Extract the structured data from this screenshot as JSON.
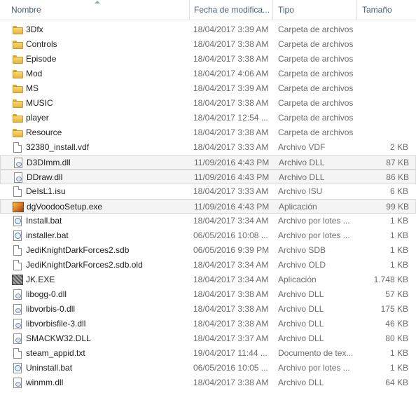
{
  "columns": {
    "name": "Nombre",
    "date": "Fecha de modifica...",
    "type": "Tipo",
    "size": "Tamaño"
  },
  "files": [
    {
      "name": "3Dfx",
      "date": "18/04/2017 3:39 AM",
      "type": "Carpeta de archivos",
      "size": "",
      "icon": "folder-icon"
    },
    {
      "name": "Controls",
      "date": "18/04/2017 3:38 AM",
      "type": "Carpeta de archivos",
      "size": "",
      "icon": "folder-icon"
    },
    {
      "name": "Episode",
      "date": "18/04/2017 3:38 AM",
      "type": "Carpeta de archivos",
      "size": "",
      "icon": "folder-icon"
    },
    {
      "name": "Mod",
      "date": "18/04/2017 4:06 AM",
      "type": "Carpeta de archivos",
      "size": "",
      "icon": "folder-icon"
    },
    {
      "name": "MS",
      "date": "18/04/2017 3:39 AM",
      "type": "Carpeta de archivos",
      "size": "",
      "icon": "folder-icon"
    },
    {
      "name": "MUSIC",
      "date": "18/04/2017 3:38 AM",
      "type": "Carpeta de archivos",
      "size": "",
      "icon": "folder-icon"
    },
    {
      "name": "player",
      "date": "18/04/2017 12:54 ...",
      "type": "Carpeta de archivos",
      "size": "",
      "icon": "folder-icon"
    },
    {
      "name": "Resource",
      "date": "18/04/2017 3:38 AM",
      "type": "Carpeta de archivos",
      "size": "",
      "icon": "folder-icon"
    },
    {
      "name": "32380_install.vdf",
      "date": "18/04/2017 3:33 AM",
      "type": "Archivo VDF",
      "size": "2 KB",
      "icon": "document-icon"
    },
    {
      "name": "D3DImm.dll",
      "date": "11/09/2016 4:43 PM",
      "type": "Archivo DLL",
      "size": "87 KB",
      "icon": "dll-icon",
      "selected": true
    },
    {
      "name": "DDraw.dll",
      "date": "11/09/2016 4:43 PM",
      "type": "Archivo DLL",
      "size": "86 KB",
      "icon": "dll-icon",
      "selected": true
    },
    {
      "name": "DeIsL1.isu",
      "date": "18/04/2017 3:33 AM",
      "type": "Archivo ISU",
      "size": "6 KB",
      "icon": "document-icon"
    },
    {
      "name": "dgVoodooSetup.exe",
      "date": "11/09/2016 4:43 PM",
      "type": "Aplicación",
      "size": "99 KB",
      "icon": "application-icon",
      "selected": true
    },
    {
      "name": "Install.bat",
      "date": "18/04/2017 3:34 AM",
      "type": "Archivo por lotes ...",
      "size": "1 KB",
      "icon": "batch-file-icon"
    },
    {
      "name": "installer.bat",
      "date": "06/05/2016 10:08 ...",
      "type": "Archivo por lotes ...",
      "size": "1 KB",
      "icon": "batch-file-icon"
    },
    {
      "name": "JediKnightDarkForces2.sdb",
      "date": "06/05/2016 9:39 PM",
      "type": "Archivo SDB",
      "size": "1 KB",
      "icon": "document-icon"
    },
    {
      "name": "JediKnightDarkForces2.sdb.old",
      "date": "18/04/2017 3:34 AM",
      "type": "Archivo OLD",
      "size": "1 KB",
      "icon": "document-icon"
    },
    {
      "name": "JK.EXE",
      "date": "18/04/2017 3:34 AM",
      "type": "Aplicación",
      "size": "1.748 KB",
      "icon": "exe-icon"
    },
    {
      "name": "libogg-0.dll",
      "date": "18/04/2017 3:38 AM",
      "type": "Archivo DLL",
      "size": "57 KB",
      "icon": "dll-icon"
    },
    {
      "name": "libvorbis-0.dll",
      "date": "18/04/2017 3:38 AM",
      "type": "Archivo DLL",
      "size": "175 KB",
      "icon": "dll-icon"
    },
    {
      "name": "libvorbisfile-3.dll",
      "date": "18/04/2017 3:38 AM",
      "type": "Archivo DLL",
      "size": "46 KB",
      "icon": "dll-icon"
    },
    {
      "name": "SMACKW32.DLL",
      "date": "18/04/2017 3:37 AM",
      "type": "Archivo DLL",
      "size": "80 KB",
      "icon": "dll-icon"
    },
    {
      "name": "steam_appid.txt",
      "date": "19/04/2017 11:44 ...",
      "type": "Documento de tex...",
      "size": "1 KB",
      "icon": "document-icon"
    },
    {
      "name": "Uninstall.bat",
      "date": "06/05/2016 10:05 ...",
      "type": "Archivo por lotes ...",
      "size": "1 KB",
      "icon": "batch-file-icon"
    },
    {
      "name": "winmm.dll",
      "date": "18/04/2017 3:38 AM",
      "type": "Archivo DLL",
      "size": "64 KB",
      "icon": "dll-icon"
    }
  ]
}
